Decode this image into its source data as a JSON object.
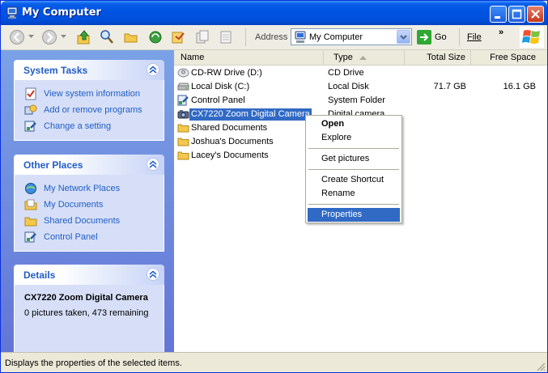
{
  "window": {
    "title": "My Computer"
  },
  "toolbar": {
    "address_label": "Address",
    "address_value": "My Computer",
    "go_label": "Go",
    "file_menu": "File",
    "chevron": "»"
  },
  "left_pane": {
    "system_tasks": {
      "title": "System Tasks",
      "items": [
        {
          "label": "View system information"
        },
        {
          "label": "Add or remove programs"
        },
        {
          "label": "Change a setting"
        }
      ]
    },
    "other_places": {
      "title": "Other Places",
      "items": [
        {
          "label": "My Network Places"
        },
        {
          "label": "My Documents"
        },
        {
          "label": "Shared Documents"
        },
        {
          "label": "Control Panel"
        }
      ]
    },
    "details": {
      "title": "Details",
      "name": "CX7220 Zoom Digital Camera",
      "info": "0 pictures taken, 473 remaining"
    }
  },
  "list": {
    "columns": [
      "Name",
      "Type",
      "Total Size",
      "Free Space"
    ],
    "rows": [
      {
        "name": "CD-RW Drive (D:)",
        "type": "CD Drive",
        "total": "",
        "free": ""
      },
      {
        "name": "Local Disk (C:)",
        "type": "Local Disk",
        "total": "71.7 GB",
        "free": "16.1 GB"
      },
      {
        "name": "Control Panel",
        "type": "System Folder",
        "total": "",
        "free": ""
      },
      {
        "name": "CX7220 Zoom Digital Camera",
        "type": "Digital camera",
        "total": "",
        "free": ""
      },
      {
        "name": "Shared Documents",
        "type": "",
        "total": "",
        "free": ""
      },
      {
        "name": "Joshua's Documents",
        "type": "",
        "total": "",
        "free": ""
      },
      {
        "name": "Lacey's Documents",
        "type": "",
        "total": "",
        "free": ""
      }
    ]
  },
  "context_menu": {
    "items": [
      "Open",
      "Explore",
      "Get pictures",
      "Create Shortcut",
      "Rename",
      "Properties"
    ]
  },
  "status_bar": {
    "text": "Displays the properties of the selected items."
  },
  "colors": {
    "selection": "#316ac5",
    "link": "#215dc6",
    "titlebar": "#0054e3"
  }
}
